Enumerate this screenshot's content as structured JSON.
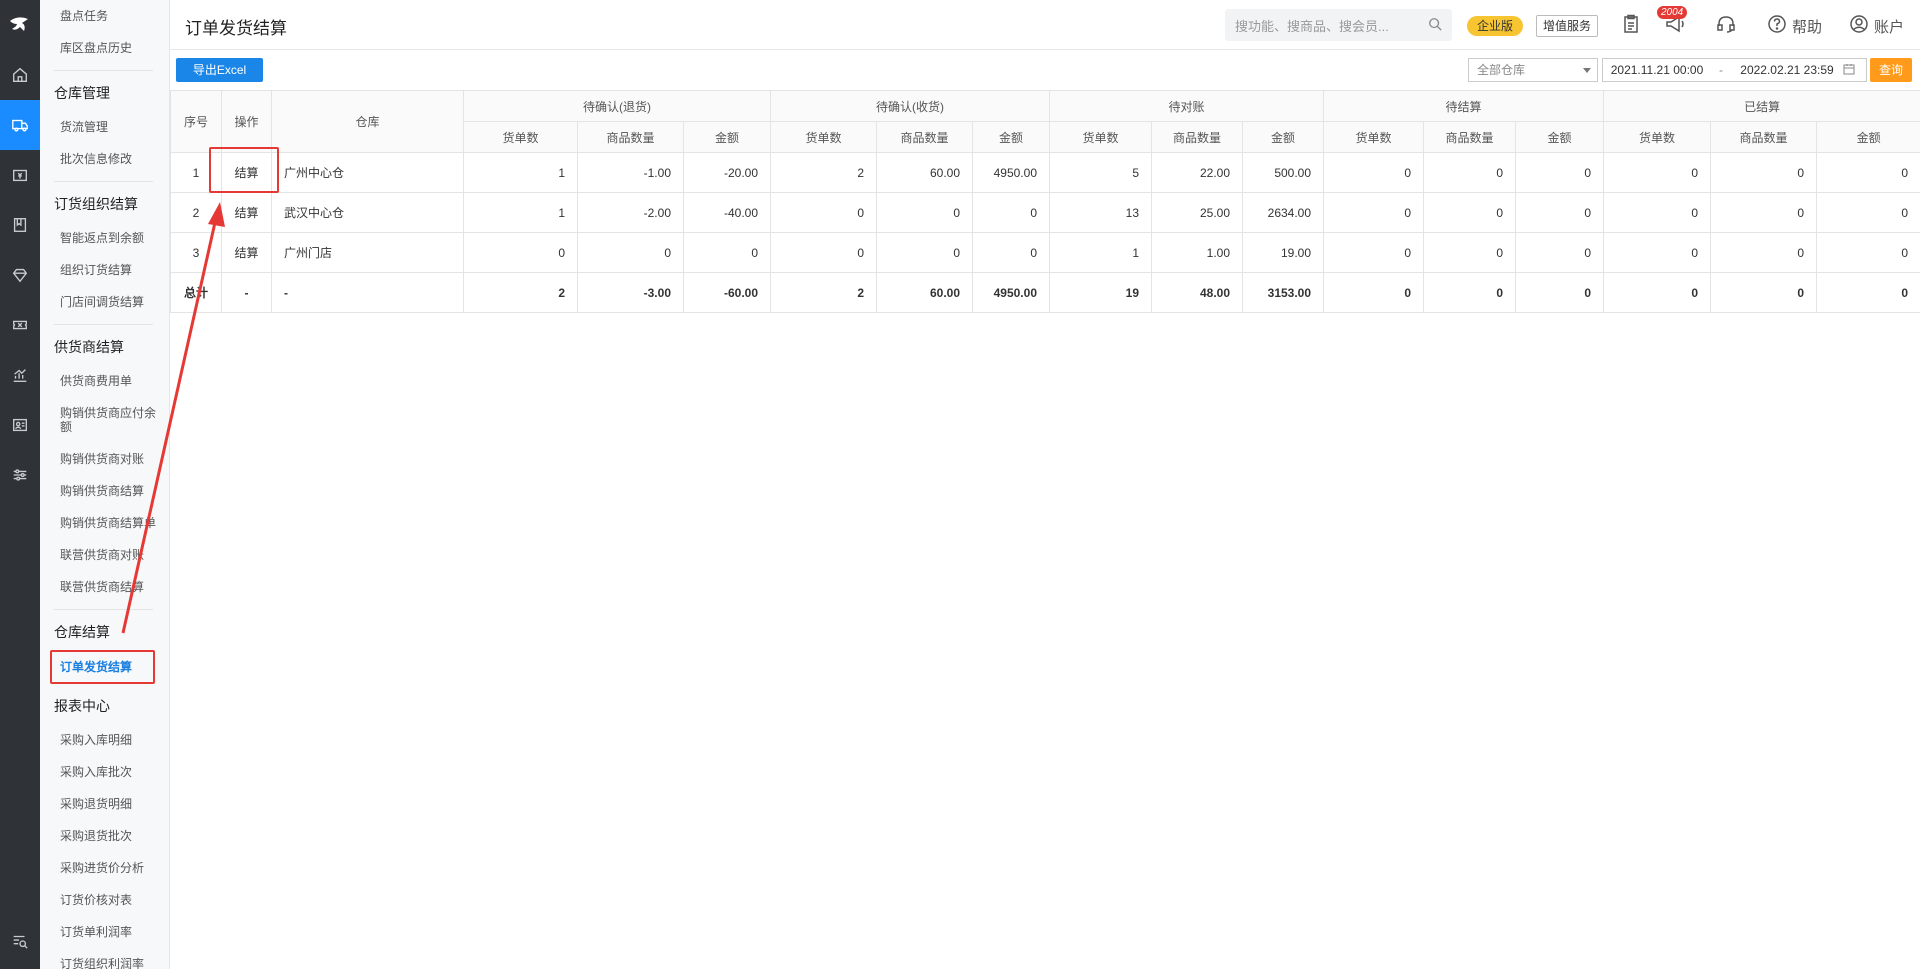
{
  "header": {
    "title": "订单发货结算",
    "search_placeholder": "搜功能、搜商品、搜会员...",
    "enterprise_badge": "企业版",
    "value_service": "增值服务",
    "notification_count": "2004",
    "help_label": "帮助",
    "account_label": "账户"
  },
  "sidebar": {
    "items": [
      {
        "type": "item",
        "label": "盘点任务"
      },
      {
        "type": "item",
        "label": "库区盘点历史"
      },
      {
        "type": "group",
        "label": "仓库管理"
      },
      {
        "type": "item",
        "label": "货流管理"
      },
      {
        "type": "item",
        "label": "批次信息修改"
      },
      {
        "type": "group",
        "label": "订货组织结算"
      },
      {
        "type": "item",
        "label": "智能返点到余额"
      },
      {
        "type": "item",
        "label": "组织订货结算"
      },
      {
        "type": "item",
        "label": "门店间调货结算"
      },
      {
        "type": "group",
        "label": "供货商结算"
      },
      {
        "type": "item",
        "label": "供货商费用单"
      },
      {
        "type": "item",
        "label": "购销供货商应付余额"
      },
      {
        "type": "item",
        "label": "购销供货商对账"
      },
      {
        "type": "item",
        "label": "购销供货商结算"
      },
      {
        "type": "item",
        "label": "购销供货商结算单"
      },
      {
        "type": "item",
        "label": "联营供货商对账"
      },
      {
        "type": "item",
        "label": "联营供货商结算"
      },
      {
        "type": "group",
        "label": "仓库结算"
      },
      {
        "type": "item",
        "label": "订单发货结算",
        "selected": true
      },
      {
        "type": "group",
        "label": "报表中心"
      },
      {
        "type": "item",
        "label": "采购入库明细"
      },
      {
        "type": "item",
        "label": "采购入库批次"
      },
      {
        "type": "item",
        "label": "采购退货明细"
      },
      {
        "type": "item",
        "label": "采购退货批次"
      },
      {
        "type": "item",
        "label": "采购进货价分析"
      },
      {
        "type": "item",
        "label": "订货价核对表"
      },
      {
        "type": "item",
        "label": "订货单利润率"
      },
      {
        "type": "item",
        "label": "订货组织利润率"
      }
    ]
  },
  "toolbar": {
    "export_label": "导出Excel",
    "warehouse_select": "全部仓库",
    "date_start": "2021.11.21 00:00",
    "date_sep": "-",
    "date_end": "2022.02.21 23:59",
    "query_label": "查询"
  },
  "table": {
    "fixed_headers": [
      "序号",
      "操作",
      "仓库"
    ],
    "groups": [
      "待确认(退货)",
      "待确认(收货)",
      "待对账",
      "待结算",
      "已结算"
    ],
    "sub_headers": [
      "货单数",
      "商品数量",
      "金额"
    ],
    "rows": [
      {
        "no": "1",
        "action": "结算",
        "warehouse": "广州中心仓",
        "cells": [
          "1",
          "-1.00",
          "-20.00",
          "2",
          "60.00",
          "4950.00",
          "5",
          "22.00",
          "500.00",
          "0",
          "0",
          "0",
          "0",
          "0",
          "0"
        ]
      },
      {
        "no": "2",
        "action": "结算",
        "warehouse": "武汉中心仓",
        "cells": [
          "1",
          "-2.00",
          "-40.00",
          "0",
          "0",
          "0",
          "13",
          "25.00",
          "2634.00",
          "0",
          "0",
          "0",
          "0",
          "0",
          "0"
        ]
      },
      {
        "no": "3",
        "action": "结算",
        "warehouse": "广州门店",
        "cells": [
          "0",
          "0",
          "0",
          "0",
          "0",
          "0",
          "1",
          "1.00",
          "19.00",
          "0",
          "0",
          "0",
          "0",
          "0",
          "0"
        ]
      }
    ],
    "total": {
      "label": "总计",
      "action": "-",
      "warehouse": "-",
      "cells": [
        "2",
        "-3.00",
        "-60.00",
        "2",
        "60.00",
        "4950.00",
        "19",
        "48.00",
        "3153.00",
        "0",
        "0",
        "0",
        "0",
        "0",
        "0"
      ]
    }
  },
  "icons": [
    "logo-icon",
    "home-icon",
    "delivery-icon",
    "wallet-icon",
    "book-icon",
    "diamond-icon",
    "ticket-icon",
    "chart-icon",
    "id-card-icon",
    "sliders-icon",
    "search-list-icon",
    "search-icon",
    "clipboard-icon",
    "megaphone-icon",
    "headset-icon",
    "help-icon",
    "user-icon"
  ],
  "colors": {
    "accent": "#1a87e8",
    "query": "#ff9a1a",
    "annotation": "#e53935",
    "badge": "#f7c531",
    "rail": "#2f3338"
  }
}
